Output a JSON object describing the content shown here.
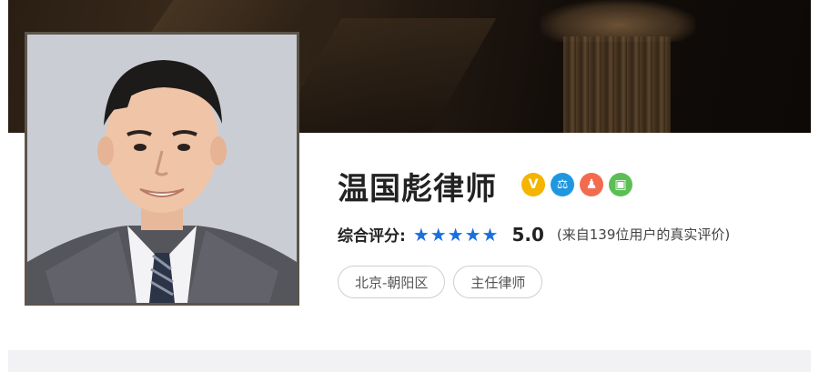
{
  "lawyer": {
    "name": "温国彪律师",
    "badges": [
      {
        "icon": "verified-v-icon",
        "glyph": "V",
        "color": "#f4b400"
      },
      {
        "icon": "scales-icon",
        "glyph": "⚖",
        "color": "#1f97e0"
      },
      {
        "icon": "person-icon",
        "glyph": "♟",
        "color": "#f36b4f"
      },
      {
        "icon": "certificate-icon",
        "glyph": "▣",
        "color": "#5cbf56"
      }
    ],
    "rating_label": "综合评分:",
    "stars": "★★★★★",
    "stars_count": 5,
    "score": "5.0",
    "review_note": "(来自139位用户的真实评价)",
    "tags": [
      "北京-朝阳区",
      "主任律师"
    ]
  },
  "colors": {
    "star": "#1a6fe0",
    "banner": "#1c140e"
  }
}
